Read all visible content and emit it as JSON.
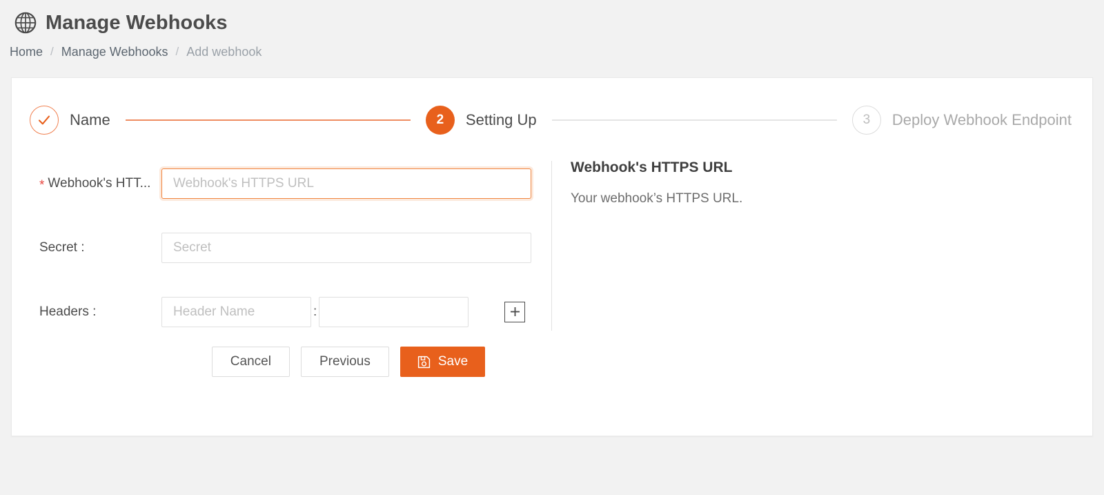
{
  "header": {
    "icon": "globe-icon",
    "title": "Manage Webhooks"
  },
  "breadcrumb": {
    "separator": "/",
    "items": [
      {
        "label": "Home",
        "current": false
      },
      {
        "label": "Manage Webhooks",
        "current": false
      },
      {
        "label": "Add webhook",
        "current": true
      }
    ]
  },
  "stepper": {
    "active_index": 2,
    "steps": [
      {
        "number": "1",
        "label": "Name",
        "state": "done",
        "marker": "check-icon"
      },
      {
        "number": "2",
        "label": "Setting Up",
        "state": "active",
        "marker": "2"
      },
      {
        "number": "3",
        "label": "Deploy Webhook Endpoint",
        "state": "todo",
        "marker": "3"
      }
    ]
  },
  "form": {
    "url_field": {
      "label": "Webhook's HTT...",
      "required_marker": "*",
      "placeholder": "Webhook's HTTPS URL",
      "value": ""
    },
    "secret_field": {
      "label": "Secret :",
      "placeholder": "Secret",
      "value": ""
    },
    "headers_field": {
      "label": "Headers :",
      "name_placeholder": "Header Name",
      "name_value": "",
      "separator": ":",
      "value_placeholder": "",
      "value_value": "",
      "add_icon": "plus-icon"
    }
  },
  "help": {
    "title": "Webhook's HTTPS URL",
    "text": "Your webhook’s HTTPS URL."
  },
  "footer": {
    "cancel_label": "Cancel",
    "previous_label": "Previous",
    "save_label": "Save",
    "save_icon": "save-disk-icon"
  },
  "colors": {
    "accent": "#e8601c",
    "accent_light": "#f08050",
    "required": "#e8463f",
    "page_bg": "#f2f2f2",
    "card_bg": "#ffffff",
    "muted_text": "#a9a9a9"
  }
}
